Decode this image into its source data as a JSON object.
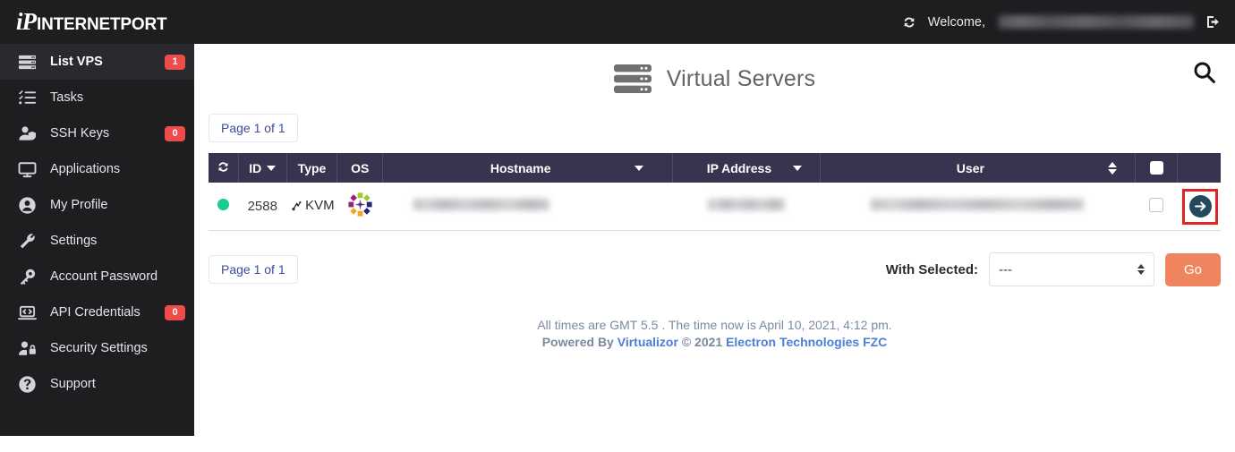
{
  "brand": {
    "ip": "iP",
    "name": "INTERNETPORT"
  },
  "topbar": {
    "refresh_icon": "refresh-icon",
    "welcome_label": "Welcome,",
    "username_redacted": "",
    "logout_icon": "logout-icon"
  },
  "sidebar": {
    "items": [
      {
        "label": "List VPS",
        "icon": "server-stack-icon",
        "badge": "1",
        "active": true
      },
      {
        "label": "Tasks",
        "icon": "task-list-icon",
        "badge": "",
        "active": false
      },
      {
        "label": "SSH Keys",
        "icon": "user-shield-icon",
        "badge": "0",
        "active": false
      },
      {
        "label": "Applications",
        "icon": "monitor-icon",
        "badge": "",
        "active": false
      },
      {
        "label": "My Profile",
        "icon": "user-circle-icon",
        "badge": "",
        "active": false
      },
      {
        "label": "Settings",
        "icon": "wrench-icon",
        "badge": "",
        "active": false
      },
      {
        "label": "Account Password",
        "icon": "key-icon",
        "badge": "",
        "active": false
      },
      {
        "label": "API Credentials",
        "icon": "laptop-code-icon",
        "badge": "0",
        "active": false
      },
      {
        "label": "Security Settings",
        "icon": "user-lock-icon",
        "badge": "",
        "active": false
      },
      {
        "label": "Support",
        "icon": "question-circle-icon",
        "badge": "",
        "active": false
      }
    ]
  },
  "page": {
    "title": "Virtual Servers",
    "title_icon": "server-rack-icon",
    "search_icon": "search-icon"
  },
  "pagination": {
    "top_label": "Page 1 of 1",
    "bottom_label": "Page 1 of 1"
  },
  "table": {
    "refresh_icon": "refresh-icon",
    "columns": [
      {
        "label": "",
        "sort": "none"
      },
      {
        "label": "ID",
        "sort": "desc"
      },
      {
        "label": "Type",
        "sort": "none"
      },
      {
        "label": "OS",
        "sort": "none"
      },
      {
        "label": "Hostname",
        "sort": "desc"
      },
      {
        "label": "IP Address",
        "sort": "desc"
      },
      {
        "label": "User",
        "sort": "both"
      },
      {
        "label": "",
        "sort": "none"
      },
      {
        "label": "",
        "sort": "none"
      }
    ],
    "rows": [
      {
        "status": "online",
        "id": "2588",
        "type": "KVM",
        "os": "centos",
        "hostname_redacted": "",
        "ip_redacted": "",
        "user_redacted": "",
        "selected": false,
        "action_icon": "arrow-right-circle-icon"
      }
    ]
  },
  "with_selected": {
    "label": "With Selected:",
    "selected_option": "---",
    "options": [
      "---"
    ],
    "go_label": "Go"
  },
  "footer": {
    "line1": "All times are GMT 5.5 . The time now is April 10, 2021, 4:12 pm.",
    "powered_prefix": "Powered By ",
    "powered_link": "Virtualizor",
    "copyright": " © 2021 ",
    "company_link": "Electron Technologies FZC"
  },
  "colors": {
    "sidebar_bg": "#1e1e21",
    "table_header_bg": "#393350",
    "badge_red": "#ef4b4b",
    "go_orange": "#f0845e",
    "status_green": "#19cc8c",
    "action_circle": "#224a5c",
    "annotation_red": "#e02424",
    "link_blue": "#4b7fd6"
  }
}
